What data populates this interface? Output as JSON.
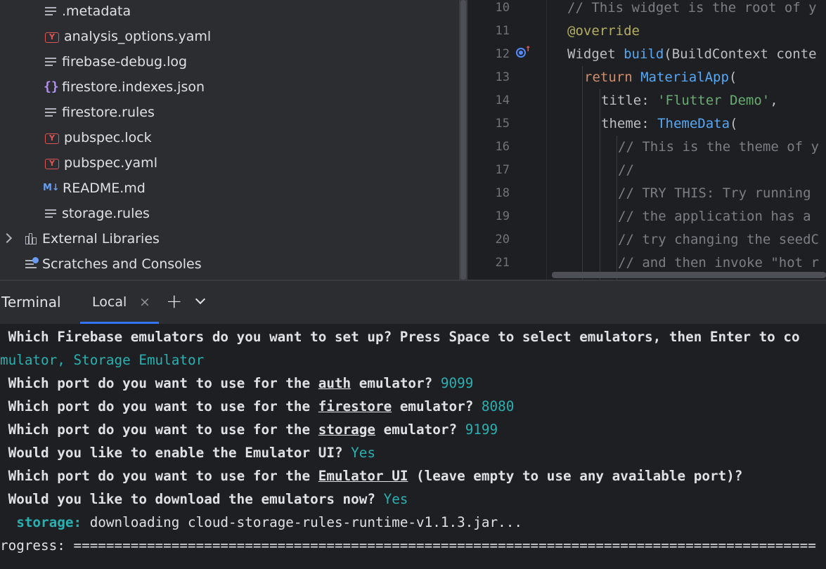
{
  "project": {
    "files": [
      {
        "name": ".metadata",
        "icon": "text-file-icon"
      },
      {
        "name": "analysis_options.yaml",
        "icon": "yaml-file-icon"
      },
      {
        "name": "firebase-debug.log",
        "icon": "text-file-icon"
      },
      {
        "name": "firestore.indexes.json",
        "icon": "json-file-icon"
      },
      {
        "name": "firestore.rules",
        "icon": "text-file-icon"
      },
      {
        "name": "pubspec.lock",
        "icon": "yaml-file-icon"
      },
      {
        "name": "pubspec.yaml",
        "icon": "yaml-file-icon"
      },
      {
        "name": "README.md",
        "icon": "markdown-file-icon"
      },
      {
        "name": "storage.rules",
        "icon": "text-file-icon"
      }
    ],
    "external_libraries": "External Libraries",
    "scratches": "Scratches and Consoles",
    "yaml_glyph": "Y",
    "json_glyph": "{}",
    "md_glyph": "M↓"
  },
  "editor": {
    "line_numbers": [
      "10",
      "11",
      "12",
      "13",
      "14",
      "15",
      "16",
      "17",
      "18",
      "19",
      "20",
      "21"
    ],
    "lines": {
      "l10": "// This widget is the root of y",
      "l11": "@override",
      "l12_kw": "Widget ",
      "l12_fn": "build",
      "l12_rest": "(BuildContext conte",
      "l13_kw": "return ",
      "l13_cls": "MaterialApp",
      "l13_rest": "(",
      "l14_key": "title: ",
      "l14_str": "'Flutter Demo'",
      "l14_rest": ",",
      "l15_key": "theme: ",
      "l15_cls": "ThemeData",
      "l15_rest": "(",
      "l16": "// This is the theme of y",
      "l17": "//",
      "l18": "// TRY THIS: Try running ",
      "l19": "// the application has a ",
      "l20": "// try changing the seedC",
      "l21": "// and then invoke \"hot r"
    }
  },
  "terminal": {
    "title": "Terminal",
    "tab_label": "Local",
    "close_glyph": "×",
    "plus_glyph": "+",
    "lines": {
      "q_emulators": " Which Firebase emulators do you want to set up? Press Space to select emulators, then Enter to co",
      "emulators_answer": "mulator, Storage Emulator",
      "port_prefix": " Which port do you want to use for the ",
      "auth": "auth",
      "firestore": "firestore",
      "storage": "storage",
      "emulator_suffix": " emulator? ",
      "auth_port": "9099",
      "firestore_port": "8080",
      "storage_port": "9199",
      "q_ui": " Would you like to enable the Emulator UI? ",
      "ui_answer": "Yes",
      "emulator_ui": "Emulator UI",
      "ui_port_suffix": " (leave empty to use any available port)?",
      "q_download": " Would you like to download the emulators now? ",
      "download_answer": "Yes",
      "storage_label": "  storage:",
      "downloading": " downloading cloud-storage-rules-runtime-v1.1.3.jar...",
      "progress": "rogress: ==========================================================================================="
    }
  }
}
